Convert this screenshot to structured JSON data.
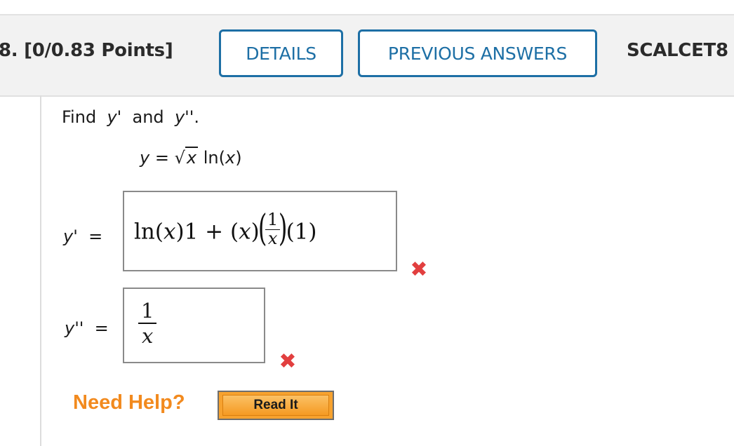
{
  "header": {
    "question_number": "8.",
    "points": "[0/0.83 Points]",
    "details_label": "DETAILS",
    "previous_answers_label": "PREVIOUS ANSWERS",
    "source_code": "SCALCET8"
  },
  "problem": {
    "prompt_find": "Find",
    "prompt_y1": "y'",
    "prompt_and": "and",
    "prompt_y2": "y''",
    "prompt_period": ".",
    "eq_lhs": "y",
    "eq_equals": "=",
    "eq_sqrt_symbol": "√",
    "eq_radicand": "x",
    "eq_ln": "ln(",
    "eq_ln_arg": "x",
    "eq_ln_close": ")"
  },
  "answers": [
    {
      "label": "y'",
      "equals": "=",
      "response": {
        "part1_ln": "ln",
        "part1_open": "(",
        "part1_var": "x",
        "part1_close": ")1 + (",
        "part2_var": "x",
        "part2_close": ")",
        "frac_num": "1",
        "frac_den": "x",
        "tail": "(1)"
      },
      "status_icon": "incorrect-icon",
      "status_mark": "✖"
    },
    {
      "label": "y''",
      "equals": "=",
      "response": {
        "frac_num": "1",
        "frac_den": "x"
      },
      "status_icon": "incorrect-icon",
      "status_mark": "✖"
    }
  ],
  "help": {
    "need_help_label": "Need Help?",
    "read_it_label": "Read It"
  },
  "colors": {
    "button_border": "#1d6fa5",
    "incorrect": "#e23f3f",
    "need_help": "#f28a1e",
    "read_it_bg": "#f7a22e"
  }
}
